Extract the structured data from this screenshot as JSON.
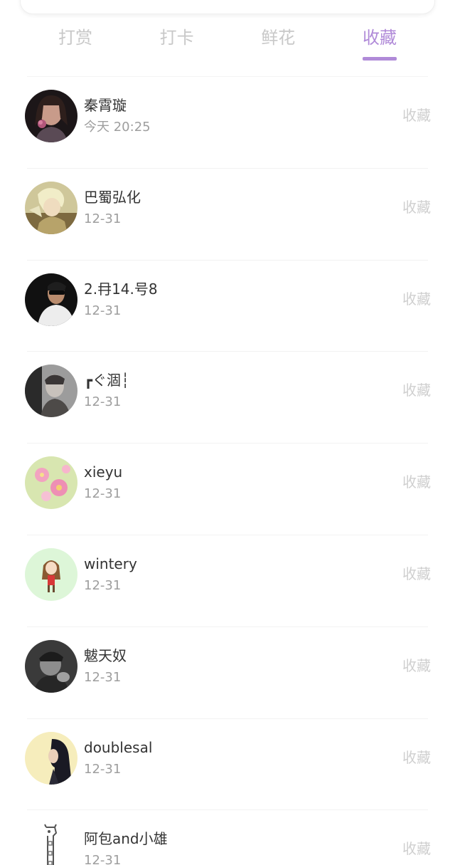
{
  "tabs": [
    {
      "label": "打赏",
      "active": false
    },
    {
      "label": "打卡",
      "active": false
    },
    {
      "label": "鲜花",
      "active": false
    },
    {
      "label": "收藏",
      "active": true
    }
  ],
  "colors": {
    "accent": "#b08ad8",
    "tab_inactive": "#c8c8c8",
    "name_text": "#333333",
    "time_text": "#9e9e9e",
    "action_text": "#cfcfcf"
  },
  "list": {
    "items": [
      {
        "name": "秦霄璇",
        "time": "今天 20:25",
        "action": "收藏",
        "avatar": "avatar-woman-flower"
      },
      {
        "name": "巴蜀弘化",
        "time": "12-31",
        "action": "收藏",
        "avatar": "avatar-anime-character"
      },
      {
        "name": "2.冄14.号8",
        "time": "12-31",
        "action": "收藏",
        "avatar": "avatar-man-sunglasses"
      },
      {
        "name": "┏ぐ涸┆",
        "time": "12-31",
        "action": "收藏",
        "avatar": "avatar-man-portrait"
      },
      {
        "name": "xieyu",
        "time": "12-31",
        "action": "收藏",
        "avatar": "avatar-pink-flowers"
      },
      {
        "name": "wintery",
        "time": "12-31",
        "action": "收藏",
        "avatar": "avatar-cartoon-girl"
      },
      {
        "name": "魃天奴",
        "time": "12-31",
        "action": "收藏",
        "avatar": "avatar-bw-man"
      },
      {
        "name": "doublesal",
        "time": "12-31",
        "action": "收藏",
        "avatar": "avatar-girl-dark-hair"
      },
      {
        "name": "阿包and小雄",
        "time": "12-31",
        "action": "收藏",
        "avatar": "avatar-giraffe-sketch"
      }
    ]
  }
}
